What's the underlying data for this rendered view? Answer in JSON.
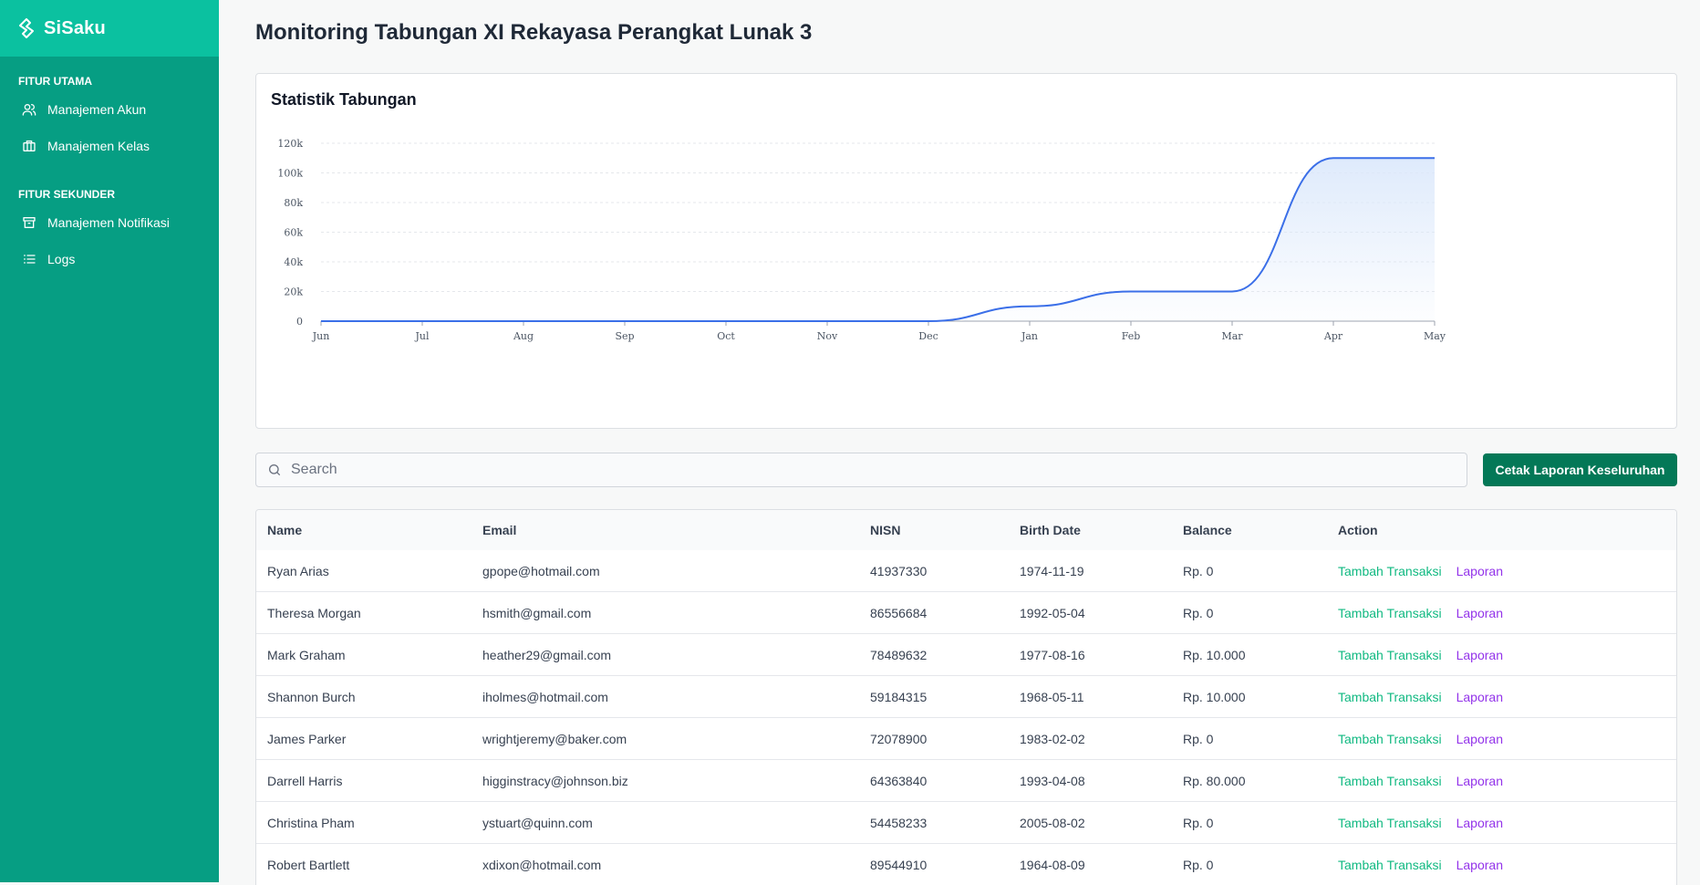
{
  "app": {
    "name": "SiSaku"
  },
  "sidebar": {
    "sections": [
      {
        "title": "FITUR UTAMA",
        "items": [
          {
            "label": "Manajemen Akun",
            "icon": "users-icon"
          },
          {
            "label": "Manajemen Kelas",
            "icon": "briefcase-icon"
          }
        ]
      },
      {
        "title": "FITUR SEKUNDER",
        "items": [
          {
            "label": "Manajemen Notifikasi",
            "icon": "archive-icon"
          },
          {
            "label": "Logs",
            "icon": "list-icon"
          }
        ]
      }
    ]
  },
  "page": {
    "title": "Monitoring Tabungan XI Rekayasa Perangkat Lunak 3"
  },
  "chart_data": {
    "type": "area",
    "title": "Statistik Tabungan",
    "categories": [
      "Jun",
      "Jul",
      "Aug",
      "Sep",
      "Oct",
      "Nov",
      "Dec",
      "Jan",
      "Feb",
      "Mar",
      "Apr",
      "May"
    ],
    "series": [
      {
        "values": [
          0,
          0,
          0,
          0,
          0,
          0,
          0,
          10000,
          20000,
          20000,
          110000,
          110000
        ]
      }
    ],
    "yticks": [
      "0",
      "20k",
      "40k",
      "60k",
      "80k",
      "100k",
      "120k"
    ],
    "ylim": [
      0,
      120000
    ],
    "grid": true,
    "colors": {
      "line": "#3b6fe8",
      "fill": "#dbe8fb"
    }
  },
  "search": {
    "placeholder": "Search"
  },
  "actions": {
    "print_all": "Cetak Laporan Keseluruhan"
  },
  "table": {
    "headers": {
      "name": "Name",
      "email": "Email",
      "nisn": "NISN",
      "birth": "Birth Date",
      "balance": "Balance",
      "action": "Action"
    },
    "action_labels": {
      "add": "Tambah Transaksi",
      "report": "Laporan"
    },
    "rows": [
      {
        "name": "Ryan Arias",
        "email": "gpope@hotmail.com",
        "nisn": "41937330",
        "birth": "1974-11-19",
        "balance": "Rp. 0"
      },
      {
        "name": "Theresa Morgan",
        "email": "hsmith@gmail.com",
        "nisn": "86556684",
        "birth": "1992-05-04",
        "balance": "Rp. 0"
      },
      {
        "name": "Mark Graham",
        "email": "heather29@gmail.com",
        "nisn": "78489632",
        "birth": "1977-08-16",
        "balance": "Rp. 10.000"
      },
      {
        "name": "Shannon Burch",
        "email": "iholmes@hotmail.com",
        "nisn": "59184315",
        "birth": "1968-05-11",
        "balance": "Rp. 10.000"
      },
      {
        "name": "James Parker",
        "email": "wrightjeremy@baker.com",
        "nisn": "72078900",
        "birth": "1983-02-02",
        "balance": "Rp. 0"
      },
      {
        "name": "Darrell Harris",
        "email": "higginstracy@johnson.biz",
        "nisn": "64363840",
        "birth": "1993-04-08",
        "balance": "Rp. 80.000"
      },
      {
        "name": "Christina Pham",
        "email": "ystuart@quinn.com",
        "nisn": "54458233",
        "birth": "2005-08-02",
        "balance": "Rp. 0"
      },
      {
        "name": "Robert Bartlett",
        "email": "xdixon@hotmail.com",
        "nisn": "89544910",
        "birth": "1964-08-09",
        "balance": "Rp. 0"
      }
    ]
  }
}
